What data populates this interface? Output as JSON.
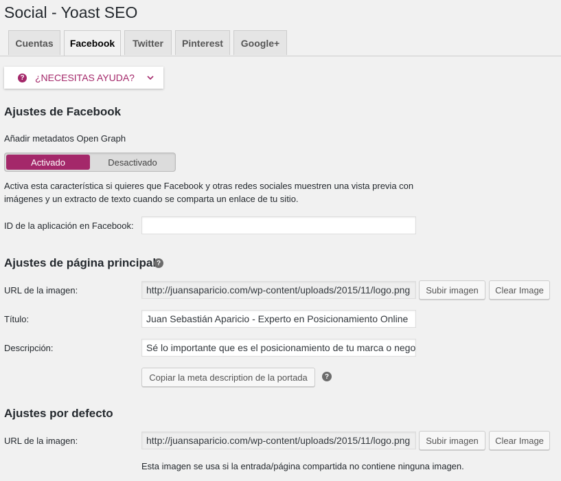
{
  "page": {
    "title": "Social - Yoast SEO"
  },
  "tabs": [
    {
      "label": "Cuentas",
      "active": false
    },
    {
      "label": "Facebook",
      "active": true
    },
    {
      "label": "Twitter",
      "active": false
    },
    {
      "label": "Pinterest",
      "active": false
    },
    {
      "label": "Google+",
      "active": false
    }
  ],
  "help": {
    "label": "¿NECESITAS AYUDA?",
    "icon": "question-circle-icon",
    "chevron_icon": "chevron-down-icon"
  },
  "facebook_settings": {
    "heading": "Ajustes de Facebook",
    "opengraph_label": "Añadir metadatos Open Graph",
    "toggle": {
      "on_label": "Activado",
      "off_label": "Desactivado",
      "selected": "Activado"
    },
    "description": "Activa esta característica si quieres que Facebook y otras redes sociales muestren una vista previa con imágenes y un extracto de texto cuando se comparta un enlace de tu sitio.",
    "app_id_label": "ID de la aplicación en Facebook:",
    "app_id_value": ""
  },
  "homepage_settings": {
    "heading": "Ajustes de página principal",
    "image_url_label": "URL de la imagen:",
    "image_url_value": "http://juansaparicio.com/wp-content/uploads/2015/11/logo.png",
    "upload_button": "Subir imagen",
    "clear_button": "Clear Image",
    "title_label": "Título:",
    "title_value": "Juan Sebastián Aparicio - Experto en Posicionamiento Online",
    "description_label": "Descripción:",
    "description_value": "Sé lo importante que es el posicionamiento de tu marca o negocio",
    "copy_button": "Copiar la meta description de la portada"
  },
  "default_settings": {
    "heading": "Ajustes por defecto",
    "image_url_label": "URL de la imagen:",
    "image_url_value": "http://juansaparicio.com/wp-content/uploads/2015/11/logo.png",
    "upload_button": "Subir imagen",
    "clear_button": "Clear Image",
    "note": "Esta imagen se usa si la entrada/página compartida no contiene ninguna imagen."
  },
  "colors": {
    "accent": "#a4286a",
    "background": "#f1f1f1"
  }
}
